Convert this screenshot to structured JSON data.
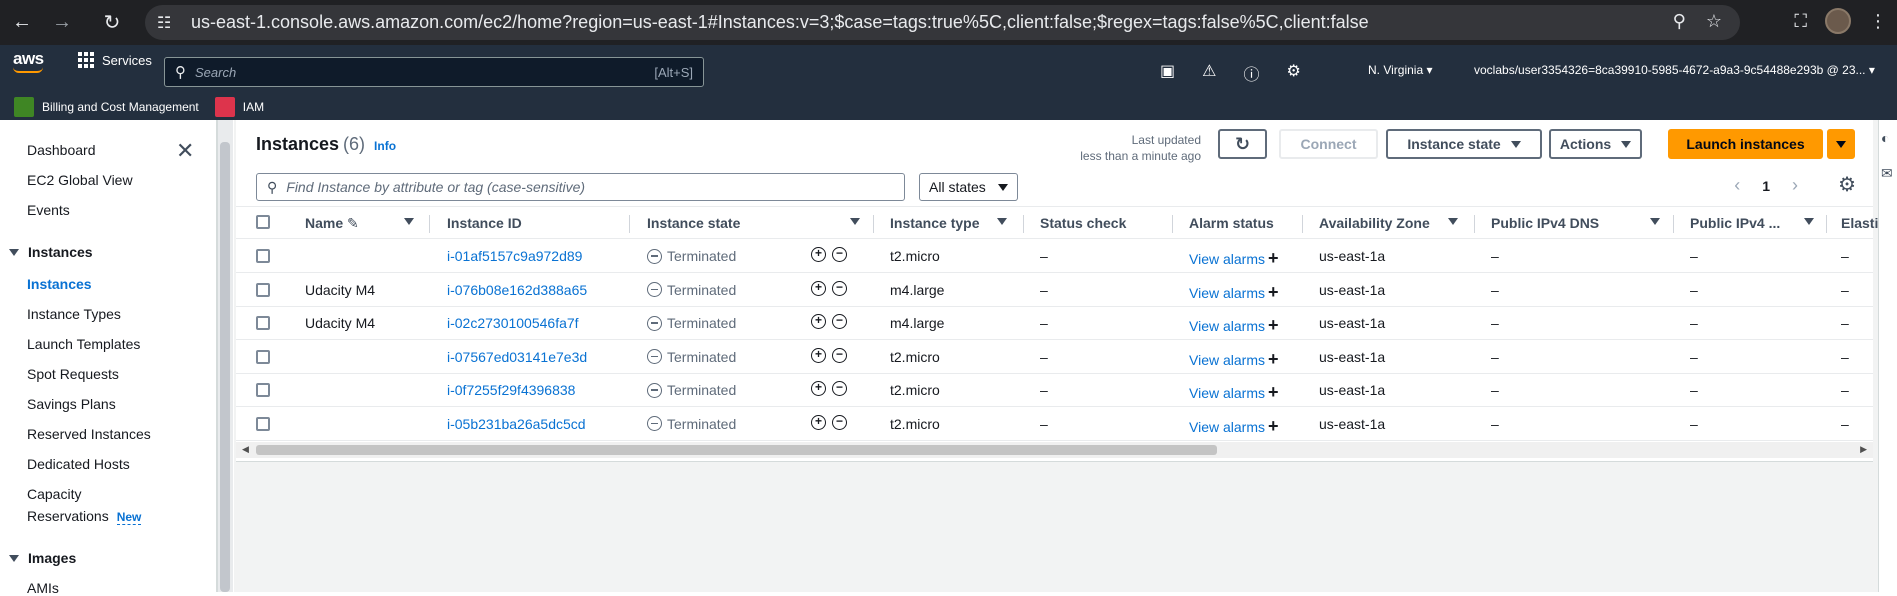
{
  "browser": {
    "url": "us-east-1.console.aws.amazon.com/ec2/home?region=us-east-1#Instances:v=3;$case=tags:true%5C,client:false;$regex=tags:false%5C,client:false"
  },
  "topnav": {
    "services_label": "Services",
    "search_placeholder": "Search",
    "search_shortcut": "[Alt+S]",
    "region": "N. Virginia",
    "account": "voclabs/user3354326=8ca39910-5985-4672-a9a3-9c54488e293b @ 23..."
  },
  "favorites": [
    {
      "label": "Billing and Cost Management",
      "color": "#3f8624"
    },
    {
      "label": "IAM",
      "color": "#dd344c"
    }
  ],
  "sidebar": {
    "top_items": [
      "Dashboard",
      "EC2 Global View",
      "Events"
    ],
    "sections": [
      {
        "label": "Instances",
        "items": [
          "Instances",
          "Instance Types",
          "Launch Templates",
          "Spot Requests",
          "Savings Plans",
          "Reserved Instances",
          "Dedicated Hosts",
          "Capacity",
          "Reservations"
        ]
      },
      {
        "label": "Images",
        "items": [
          "AMIs"
        ]
      }
    ],
    "new_badge": "New",
    "active": "Instances"
  },
  "header": {
    "title": "Instances",
    "count": "(6)",
    "info": "Info",
    "last_updated_line1": "Last updated",
    "last_updated_line2": "less than a minute ago",
    "connect": "Connect",
    "instance_state": "Instance state",
    "actions": "Actions",
    "launch": "Launch instances"
  },
  "filter": {
    "placeholder": "Find Instance by attribute or tag (case-sensitive)",
    "states": "All states",
    "page": "1"
  },
  "table": {
    "columns": [
      "Name",
      "Instance ID",
      "Instance state",
      "Instance type",
      "Status check",
      "Alarm status",
      "Availability Zone",
      "Public IPv4 DNS",
      "Public IPv4 ...",
      "Elasti"
    ],
    "rows": [
      {
        "name": "",
        "id": "i-01af5157c9a972d89",
        "state": "Terminated",
        "type": "t2.micro",
        "status": "–",
        "alarm": "View alarms",
        "az": "us-east-1a",
        "dns": "–",
        "ip": "–",
        "elastic": "–"
      },
      {
        "name": "Udacity M4",
        "id": "i-076b08e162d388a65",
        "state": "Terminated",
        "type": "m4.large",
        "status": "–",
        "alarm": "View alarms",
        "az": "us-east-1a",
        "dns": "–",
        "ip": "–",
        "elastic": "–"
      },
      {
        "name": "Udacity M4",
        "id": "i-02c2730100546fa7f",
        "state": "Terminated",
        "type": "m4.large",
        "status": "–",
        "alarm": "View alarms",
        "az": "us-east-1a",
        "dns": "–",
        "ip": "–",
        "elastic": "–"
      },
      {
        "name": "",
        "id": "i-07567ed03141e7e3d",
        "state": "Terminated",
        "type": "t2.micro",
        "status": "–",
        "alarm": "View alarms",
        "az": "us-east-1a",
        "dns": "–",
        "ip": "–",
        "elastic": "–"
      },
      {
        "name": "",
        "id": "i-0f7255f29f4396838",
        "state": "Terminated",
        "type": "t2.micro",
        "status": "–",
        "alarm": "View alarms",
        "az": "us-east-1a",
        "dns": "–",
        "ip": "–",
        "elastic": "–"
      },
      {
        "name": "",
        "id": "i-05b231ba26a5dc5cd",
        "state": "Terminated",
        "type": "t2.micro",
        "status": "–",
        "alarm": "View alarms",
        "az": "us-east-1a",
        "dns": "–",
        "ip": "–",
        "elastic": "–"
      }
    ]
  },
  "colors": {
    "aws_nav": "#232f3e",
    "primary": "#ff9900",
    "link": "#0972d3"
  }
}
